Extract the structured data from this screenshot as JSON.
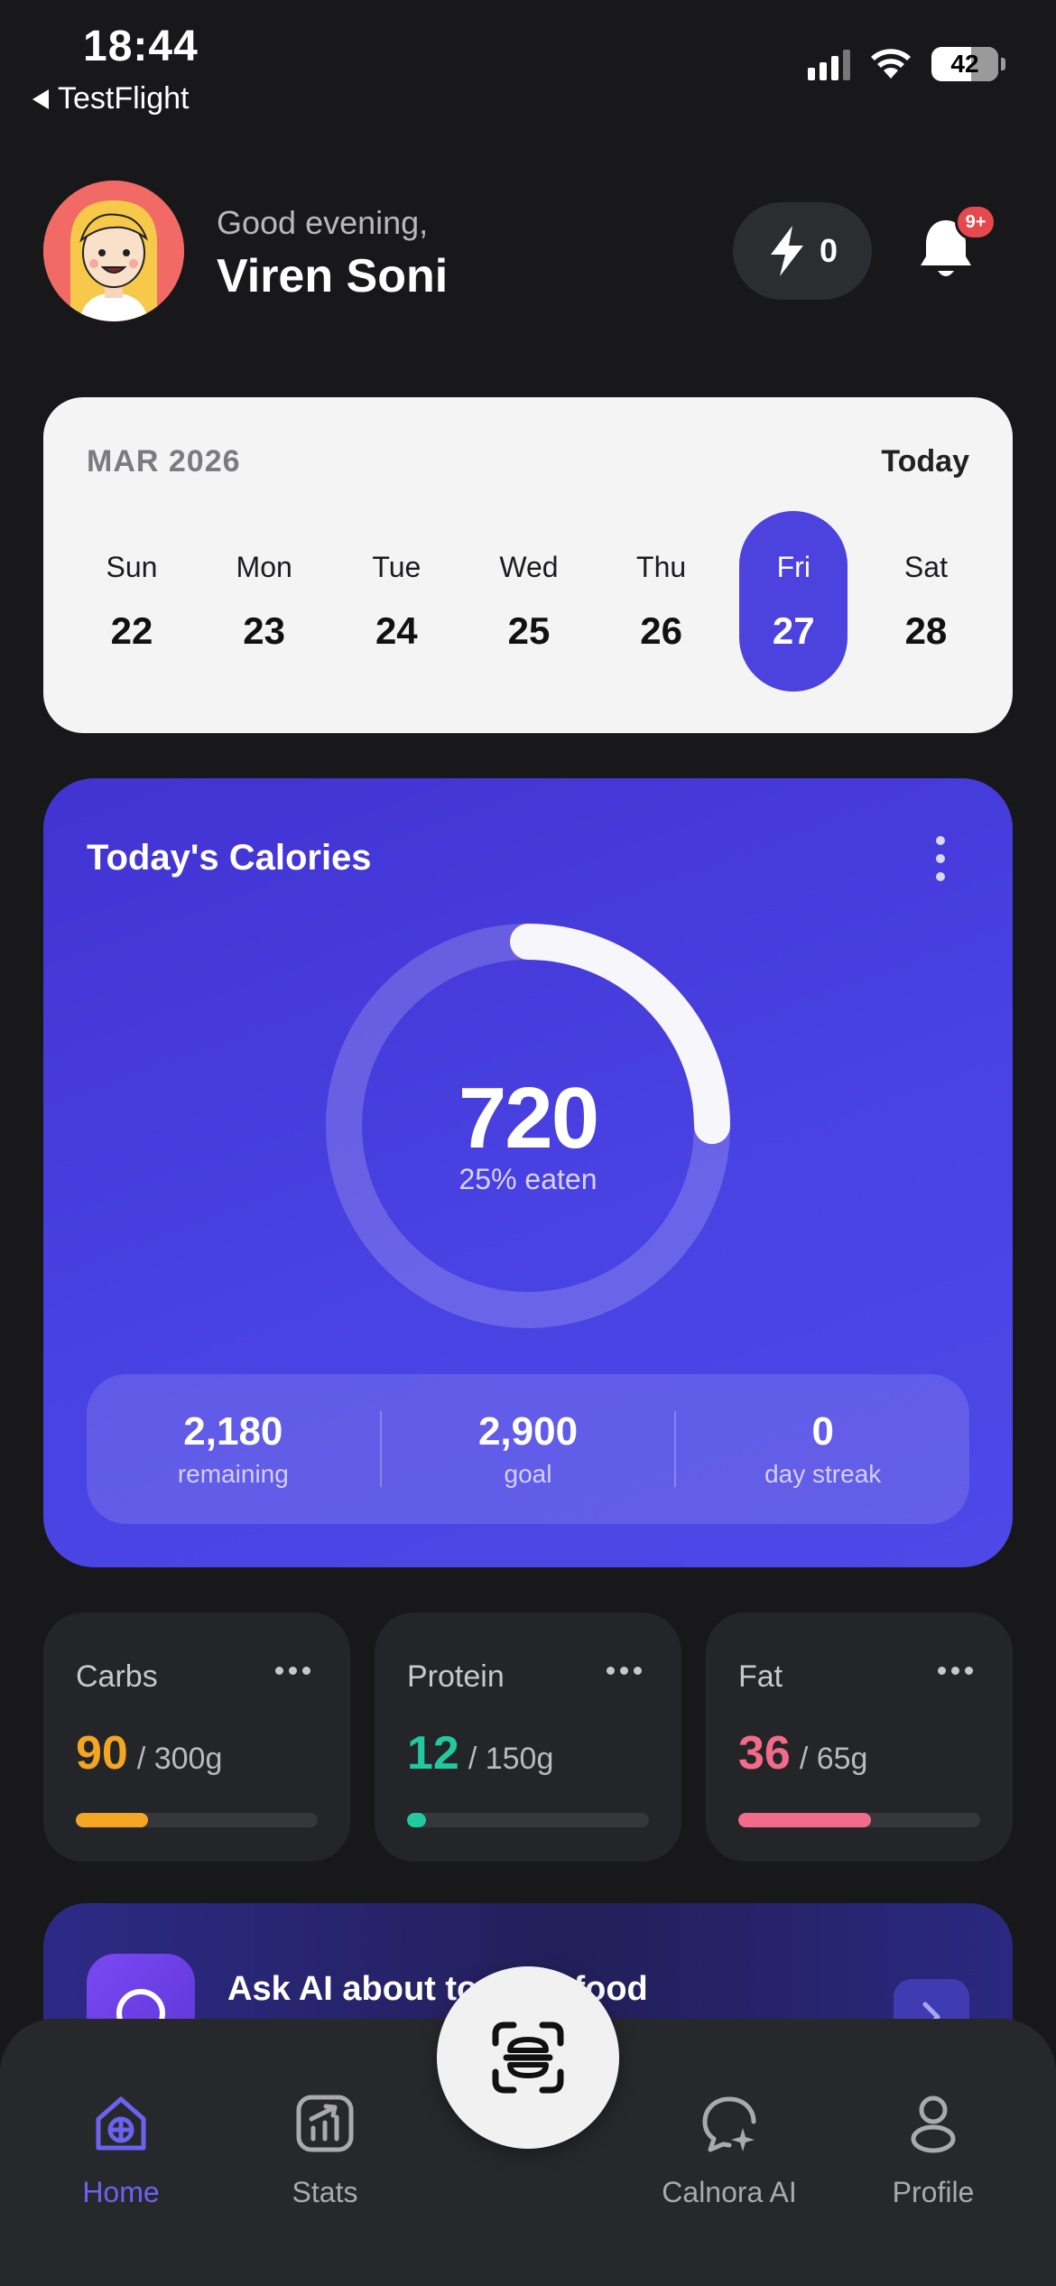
{
  "status_bar": {
    "time": "18:44",
    "back_label": "TestFlight",
    "battery": "42"
  },
  "header": {
    "greeting": "Good evening,",
    "user_name": "Viren Soni",
    "streak_count": "0",
    "notification_badge": "9+"
  },
  "calendar": {
    "month_label": "MAR 2026",
    "today_label": "Today",
    "days": [
      {
        "name": "Sun",
        "date": "22"
      },
      {
        "name": "Mon",
        "date": "23"
      },
      {
        "name": "Tue",
        "date": "24"
      },
      {
        "name": "Wed",
        "date": "25"
      },
      {
        "name": "Thu",
        "date": "26"
      },
      {
        "name": "Fri",
        "date": "27"
      },
      {
        "name": "Sat",
        "date": "28"
      }
    ],
    "selected_day": "Fri"
  },
  "calories": {
    "title": "Today's Calories",
    "value": "720",
    "eaten_label": "25% eaten",
    "progress": 0.25,
    "stats": [
      {
        "value": "2,180",
        "label": "remaining"
      },
      {
        "value": "2,900",
        "label": "goal"
      },
      {
        "value": "0",
        "label": "day streak"
      }
    ]
  },
  "macros": [
    {
      "name": "Carbs",
      "value": "90",
      "goal": "/ 300g",
      "fraction": 0.3,
      "color": "#f5a524"
    },
    {
      "name": "Protein",
      "value": "12",
      "goal": "/ 150g",
      "fraction": 0.08,
      "color": "#22c8a0"
    },
    {
      "name": "Fat",
      "value": "36",
      "goal": "/ 65g",
      "fraction": 0.55,
      "color": "#f26b8a"
    }
  ],
  "ask_ai": {
    "label": "Ask AI about today's food"
  },
  "tabs": [
    {
      "label": "Home",
      "icon": "home-icon"
    },
    {
      "label": "Stats",
      "icon": "stats-icon"
    },
    {
      "label": "Calnora AI",
      "icon": "ai-chat-icon"
    },
    {
      "label": "Profile",
      "icon": "profile-icon"
    }
  ],
  "colors": {
    "accent": "#4c42de",
    "background": "#18181a",
    "card": "#242528"
  }
}
